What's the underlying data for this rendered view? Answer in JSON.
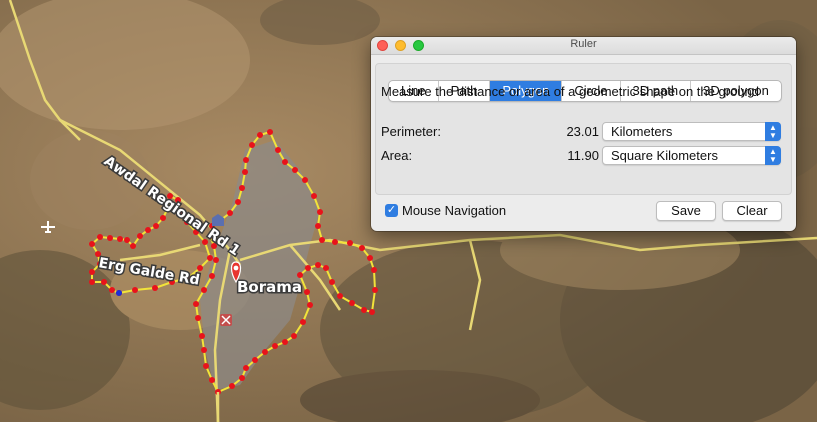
{
  "map": {
    "road_label_1": "Awdal Regional Rd 1",
    "road_label_2": "Erg Galde Rd",
    "city_label": "Borama",
    "icons": [
      "airport-icon",
      "location-pin-icon",
      "sight-icon",
      "bank-icon"
    ]
  },
  "ruler": {
    "title": "Ruler",
    "tabs": [
      {
        "label": "Line",
        "active": false
      },
      {
        "label": "Path",
        "active": false
      },
      {
        "label": "Polygon",
        "active": true
      },
      {
        "label": "Circle",
        "active": false
      },
      {
        "label": "3D path",
        "active": false
      },
      {
        "label": "3D polygon",
        "active": false
      }
    ],
    "description": "Measure the distance or area of a geometric shape on the ground",
    "perimeter": {
      "label": "Perimeter:",
      "value": "23.01",
      "unit": "Kilometers"
    },
    "area": {
      "label": "Area:",
      "value": "11.90",
      "unit": "Square Kilometers"
    },
    "mouse_navigation": {
      "label": "Mouse Navigation",
      "checked": true
    },
    "save_label": "Save",
    "clear_label": "Clear"
  },
  "colors": {
    "accent": "#2f7de1",
    "polygon_stroke": "#f2e33a",
    "vertex": "#e8131b",
    "road": "#e8d874"
  }
}
